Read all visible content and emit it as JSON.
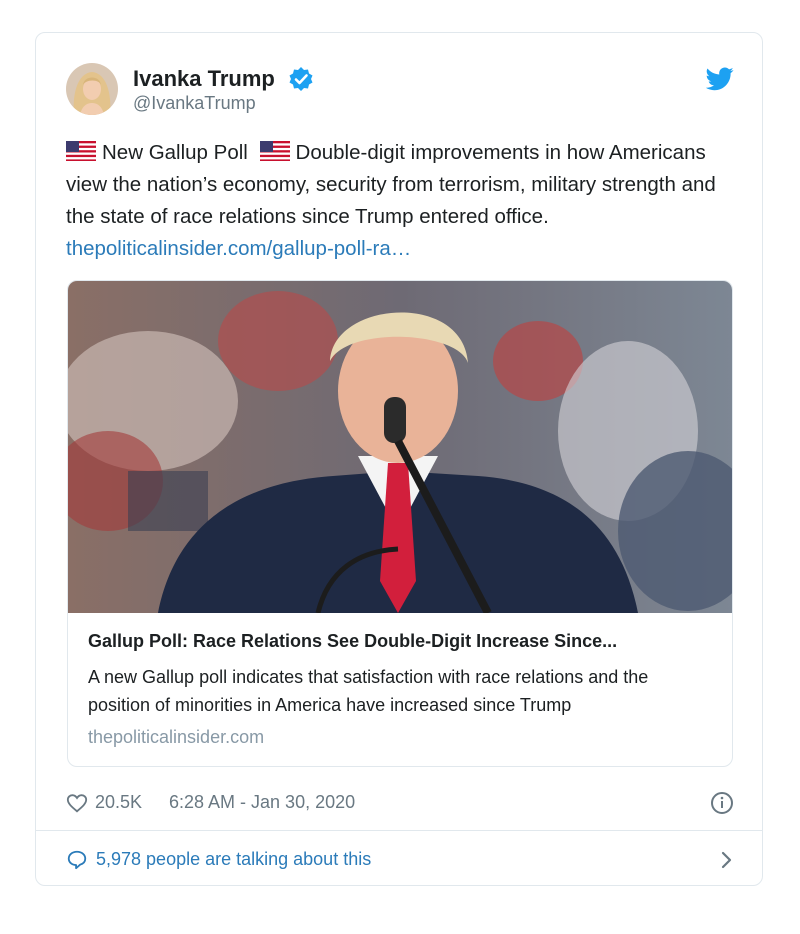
{
  "author": {
    "name": "Ivanka Trump",
    "handle": "@IvankaTrump"
  },
  "tweet": {
    "text_part1": "New Gallup Poll",
    "text_part2": "Double-digit improvements in how Americans view the nation’s economy, security from terrorism, military strength and the state of race relations since Trump entered office.",
    "link_text": "thepoliticalinsider.com/gallup-poll-ra…"
  },
  "card": {
    "title": "Gallup Poll: Race Relations See Double-Digit Increase Since...",
    "description": "A new Gallup poll indicates that satisfaction with race relations and the position of minorities in America have increased since Trump",
    "domain": "thepoliticalinsider.com"
  },
  "footer": {
    "likes": "20.5K",
    "timestamp": "6:28 AM - Jan 30, 2020",
    "talking": "5,978 people are talking about this"
  },
  "colors": {
    "link": "#2b7bb9",
    "verified": "#1da1f2",
    "muted": "#697882"
  }
}
